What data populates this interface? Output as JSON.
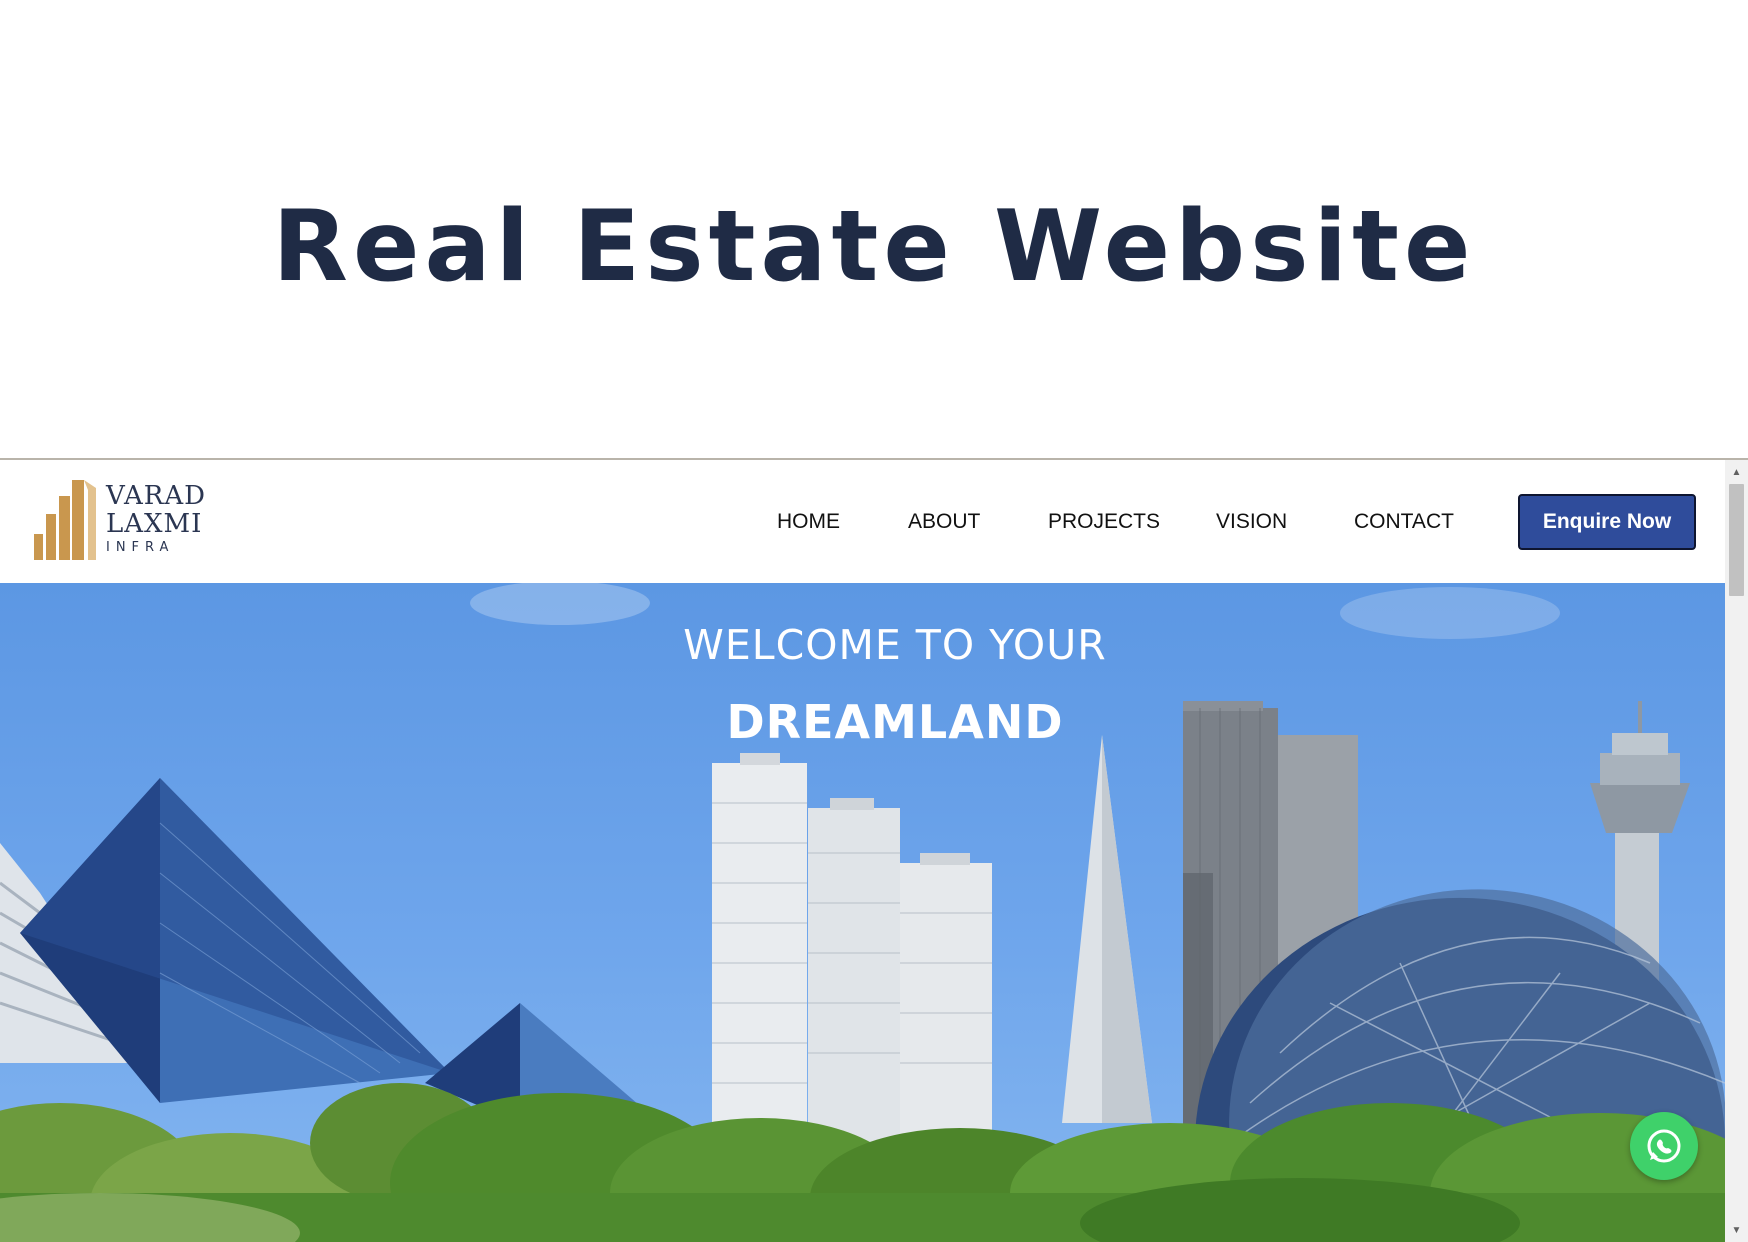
{
  "page": {
    "heading": "Real Estate Website"
  },
  "logo": {
    "line1": "VARAD",
    "line2": "LAXMI",
    "line3": "INFRA",
    "gold": "#c9974e"
  },
  "nav": {
    "items": [
      {
        "label": "HOME"
      },
      {
        "label": "ABOUT"
      },
      {
        "label": "PROJECTS"
      },
      {
        "label": "VISION"
      },
      {
        "label": "CONTACT"
      }
    ],
    "cta_label": "Enquire Now",
    "cta_color": "#2f4c9b"
  },
  "hero": {
    "welcome": "WELCOME TO YOUR",
    "title": "DREAMLAND"
  },
  "icons": {
    "whatsapp": "whatsapp-icon",
    "scroll_up": "scroll-up-arrow-icon",
    "scroll_down": "scroll-down-arrow-icon"
  }
}
